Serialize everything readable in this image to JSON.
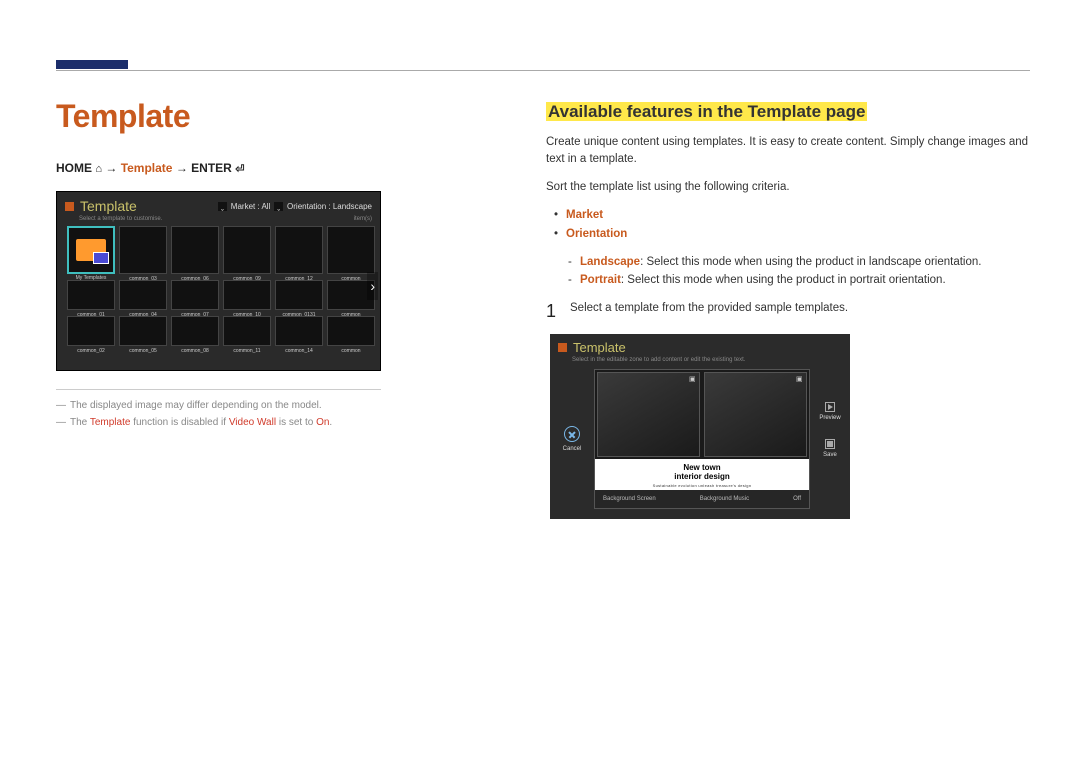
{
  "left": {
    "title": "Template",
    "breadcrumb": {
      "home": "HOME",
      "arrow": "→",
      "template": "Template",
      "enter": "ENTER"
    },
    "screenshot1": {
      "title": "Template",
      "market_label": "Market : All",
      "orientation_label": "Orientation : Landscape",
      "hint": "Select a template to customise.",
      "items_label": "item(s)",
      "first_label": "My Templates",
      "labels_row2": [
        "common_01",
        "common_04",
        "common_07",
        "common_10",
        "common_0131",
        "common"
      ],
      "labels_row3": [
        "common_02",
        "common_05",
        "common_08",
        "common_11",
        "common_14",
        "common"
      ],
      "labels_row1": [
        "",
        "common_03",
        "common_06",
        "common_09",
        "common_12",
        "common"
      ]
    },
    "notes": {
      "n1": "The displayed image may differ depending on the model.",
      "n2_pre": "The ",
      "n2_t1": "Template",
      "n2_mid": " function is disabled if ",
      "n2_t2": "Video Wall",
      "n2_mid2": " is set to ",
      "n2_t3": "On",
      "n2_post": "."
    }
  },
  "right": {
    "heading": "Available features in the Template page",
    "para1": "Create unique content using templates. It is easy to create content. Simply change images and text in a template.",
    "para2": "Sort the template list using the following criteria.",
    "bullets": {
      "b1": "Market",
      "b2": "Orientation"
    },
    "sublist": {
      "s1_term": "Landscape",
      "s1_text": ": Select this mode when using the product in landscape orientation.",
      "s2_term": "Portrait",
      "s2_text": ": Select this mode when using the product in portrait orientation."
    },
    "step1": {
      "num": "1",
      "text": "Select a template from the provided sample templates."
    },
    "screenshot2": {
      "title": "Template",
      "hint": "Select in the editable zone to add content or edit the existing text.",
      "cancel": "Cancel",
      "preview_t1": "New town",
      "preview_t2": "interior design",
      "preview_t3": "Sustainable evolution unleash treasure's design",
      "bg_screen": "Background Screen",
      "bg_music": "Background Music",
      "bg_off": "Off",
      "side_preview": "Preview",
      "side_save": "Save"
    }
  }
}
